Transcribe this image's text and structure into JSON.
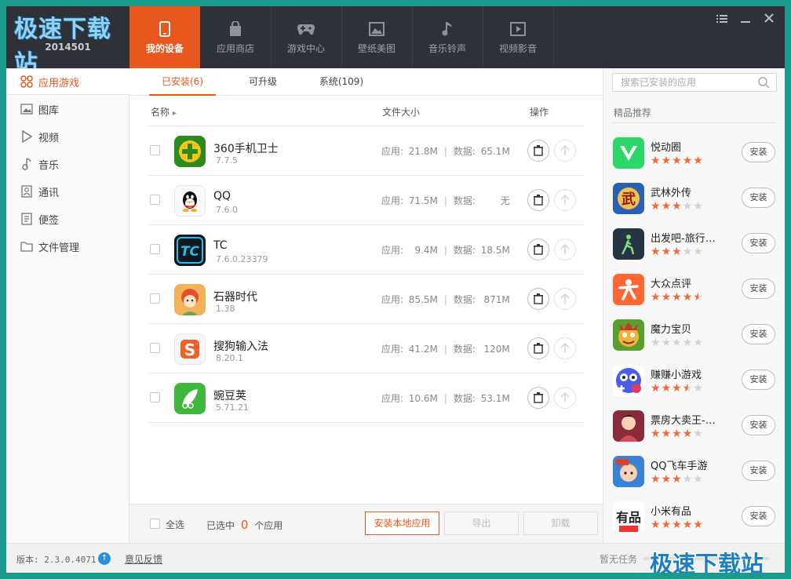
{
  "header": {
    "brand": "极速下载站",
    "device_id": "2014501",
    "tabs": [
      {
        "label": "我的设备",
        "icon": "phone-icon"
      },
      {
        "label": "应用商店",
        "icon": "bag-icon"
      },
      {
        "label": "游戏中心",
        "icon": "gamepad-icon"
      },
      {
        "label": "壁纸美图",
        "icon": "picture-icon"
      },
      {
        "label": "音乐铃声",
        "icon": "music-note-icon"
      },
      {
        "label": "视频影音",
        "icon": "video-icon"
      }
    ],
    "window_controls": [
      "menu-icon",
      "minimize-icon",
      "close-icon"
    ],
    "accent": "#e8581e",
    "bg": "#2e3238"
  },
  "sidebar": {
    "items": [
      {
        "label": "应用游戏",
        "icon": "apps-grid-icon"
      },
      {
        "label": "图库",
        "icon": "gallery-icon"
      },
      {
        "label": "视频",
        "icon": "play-icon"
      },
      {
        "label": "音乐",
        "icon": "music-icon"
      },
      {
        "label": "通讯",
        "icon": "contacts-icon"
      },
      {
        "label": "便签",
        "icon": "note-icon"
      },
      {
        "label": "文件管理",
        "icon": "folder-icon"
      }
    ]
  },
  "main": {
    "subtabs": [
      {
        "label": "已安装(6)"
      },
      {
        "label": "可升级"
      },
      {
        "label": "系统(109)"
      }
    ],
    "columns": {
      "name": "名称",
      "sort_arrow": "▸",
      "size": "文件大小",
      "action": "操作"
    },
    "size_labels": {
      "app": "应用:",
      "data": "数据:",
      "sep": "|"
    },
    "apps": [
      {
        "name": "360手机卫士",
        "version": "7.7.5",
        "app_size": "21.8M",
        "data_size": "65.1M"
      },
      {
        "name": "QQ",
        "version": "7.6.0",
        "app_size": "71.5M",
        "data_size": "无"
      },
      {
        "name": "TC",
        "version": "7.6.0.23379",
        "app_size": "9.4M",
        "data_size": "18.5M"
      },
      {
        "name": "石器时代",
        "version": "1.38",
        "app_size": "85.5M",
        "data_size": "871M"
      },
      {
        "name": "搜狗输入法",
        "version": "8.20.1",
        "app_size": "41.2M",
        "data_size": "120M"
      },
      {
        "name": "豌豆荚",
        "version": "5.71.21",
        "app_size": "10.6M",
        "data_size": "53.1M"
      }
    ],
    "footer": {
      "select_all": "全选",
      "selected_prefix": "已选中",
      "selected_count": "0",
      "selected_suffix": "个应用",
      "install_local": "安装本地应用",
      "export": "导出",
      "uninstall": "卸载"
    }
  },
  "right": {
    "search_placeholder": "搜索已安装的应用",
    "title": "精品推荐",
    "install_label": "安装",
    "recommended": [
      {
        "name": "悦动圈",
        "rating": 5
      },
      {
        "name": "武林外传",
        "rating": 3
      },
      {
        "name": "出发吧-旅行…",
        "rating": 3
      },
      {
        "name": "大众点评",
        "rating": 4.5
      },
      {
        "name": "魔力宝贝",
        "rating": 0
      },
      {
        "name": "赚赚小游戏",
        "rating": 3.5
      },
      {
        "name": "票房大卖王-…",
        "rating": 4
      },
      {
        "name": "QQ飞车手游",
        "rating": 3
      },
      {
        "name": "小米有品",
        "rating": 5
      }
    ]
  },
  "status": {
    "version": "版本: 2.3.0.4071",
    "feedback": "意见反馈",
    "task": "暂无任务",
    "watermark": "极速下载站"
  }
}
